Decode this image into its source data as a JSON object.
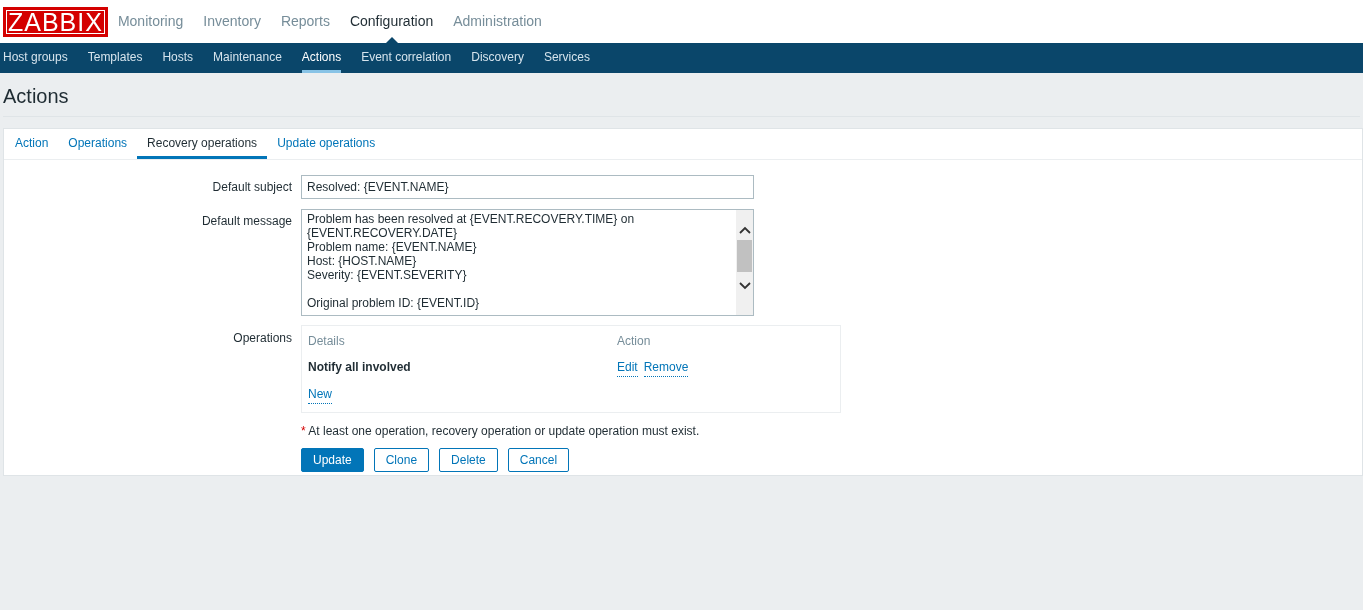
{
  "logo": "ZABBIX",
  "main_menu": [
    {
      "label": "Monitoring",
      "selected": false
    },
    {
      "label": "Inventory",
      "selected": false
    },
    {
      "label": "Reports",
      "selected": false
    },
    {
      "label": "Configuration",
      "selected": true
    },
    {
      "label": "Administration",
      "selected": false
    }
  ],
  "sub_menu": [
    {
      "label": "Host groups",
      "selected": false
    },
    {
      "label": "Templates",
      "selected": false
    },
    {
      "label": "Hosts",
      "selected": false
    },
    {
      "label": "Maintenance",
      "selected": false
    },
    {
      "label": "Actions",
      "selected": true
    },
    {
      "label": "Event correlation",
      "selected": false
    },
    {
      "label": "Discovery",
      "selected": false
    },
    {
      "label": "Services",
      "selected": false
    }
  ],
  "page_title": "Actions",
  "tabs": [
    {
      "label": "Action",
      "selected": false
    },
    {
      "label": "Operations",
      "selected": false
    },
    {
      "label": "Recovery operations",
      "selected": true
    },
    {
      "label": "Update operations",
      "selected": false
    }
  ],
  "form": {
    "subject_label": "Default subject",
    "subject_value": "Resolved: {EVENT.NAME}",
    "message_label": "Default message",
    "message_value": "Problem has been resolved at {EVENT.RECOVERY.TIME} on\n{EVENT.RECOVERY.DATE}\nProblem name: {EVENT.NAME}\nHost: {HOST.NAME}\nSeverity: {EVENT.SEVERITY}\n\nOriginal problem ID: {EVENT.ID}",
    "operations_label": "Operations",
    "operations": {
      "columns": [
        "Details",
        "Action"
      ],
      "rows": [
        {
          "details": "Notify all involved",
          "actions": [
            "Edit",
            "Remove"
          ]
        }
      ],
      "new_link": "New"
    },
    "note_mark": "*",
    "note": "At least one operation, recovery operation or update operation must exist.",
    "buttons": [
      {
        "label": "Update",
        "kind": "primary"
      },
      {
        "label": "Clone",
        "kind": "secondary"
      },
      {
        "label": "Delete",
        "kind": "secondary"
      },
      {
        "label": "Cancel",
        "kind": "secondary"
      }
    ]
  }
}
